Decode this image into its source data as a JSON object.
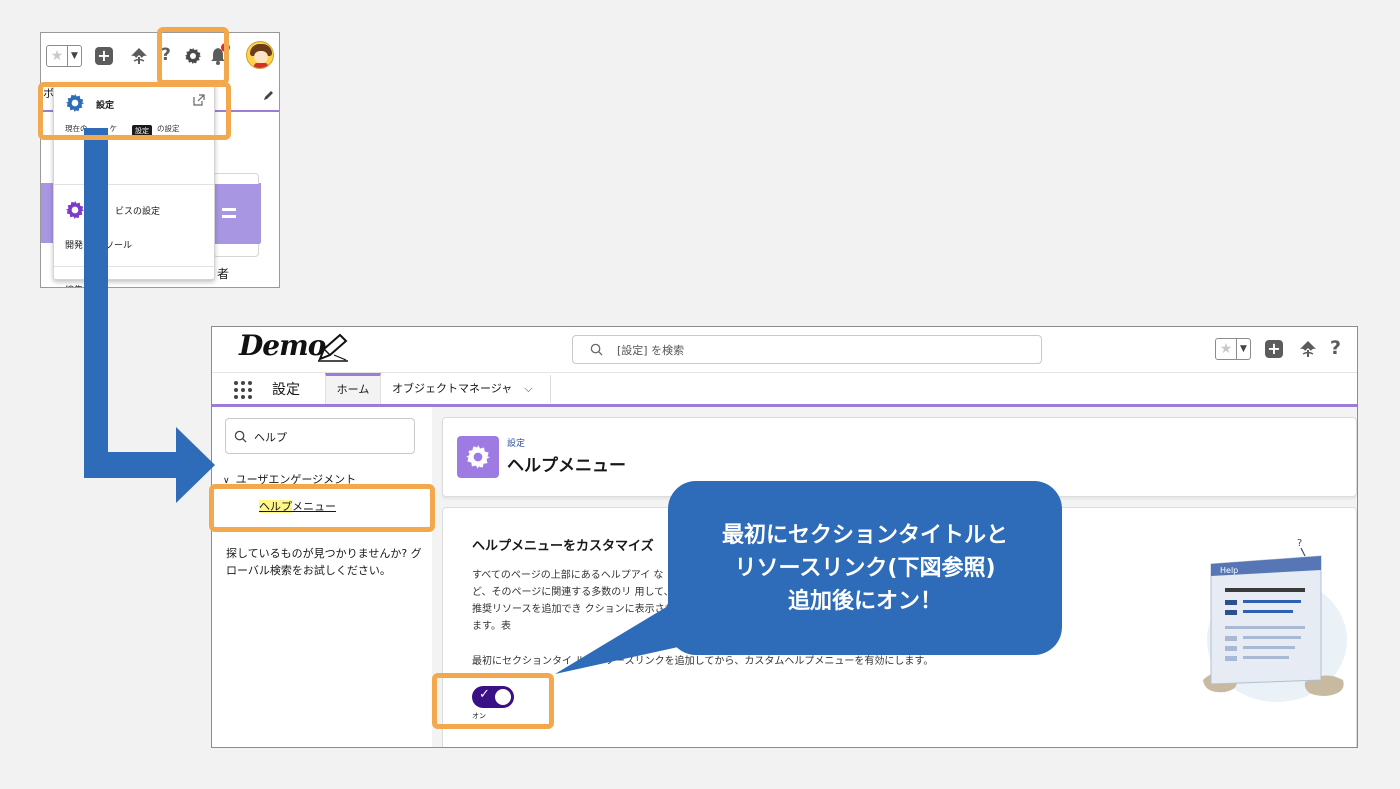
{
  "inset": {
    "settings_title": "設定",
    "settings_subtitle_a": "現在の",
    "settings_subtitle_b": "ケ",
    "settings_subtitle_c": "の設定",
    "tooltip": "設定",
    "edge_char": "ボ",
    "service_setup": "ビスの設定",
    "dev_console": "開発",
    "dev_console_b": "ソール",
    "edit_page": "編集",
    "behind_text": "者"
  },
  "header": {
    "logo": "Demo",
    "search_placeholder": "[設定] を検索"
  },
  "nav": {
    "app_name": "設定",
    "tabs": [
      {
        "label": "ホーム"
      },
      {
        "label": "オブジェクトマネージャ"
      }
    ]
  },
  "sidebar": {
    "quick_find_value": "ヘルプ",
    "section": "ユーザエンゲージメント",
    "item_highlight": "ヘルプ",
    "item_rest": "メニュー",
    "no_result": "探しているものが見つかりませんか? グローバル検索をお試しください。"
  },
  "page": {
    "breadcrumb": "設定",
    "title": "ヘルプメニュー",
    "card_title": "ヘルプメニューをカスタマイズ",
    "card_desc": "すべてのページの上部にあるヘルプアイ など、そのページに関連する多数のリ 用して、推奨リソースを追加でき クションに表示されます。表",
    "card_note": "最初にセクションタイ ルとリソースリンクを追加してから、カスタムヘルプメニューを有効にします。",
    "toggle_label": "オン",
    "illus_label": "Help",
    "illus_q": "?"
  },
  "callout": {
    "text": "最初にセクションタイトルと\nリソースリンク(下図参照)\n追加後にオン！"
  },
  "colors": {
    "highlight": "#f3a84d",
    "arrow": "#2e6bb8",
    "brand_purple": "#9b7cd9",
    "toggle_on": "#3b0f86"
  }
}
